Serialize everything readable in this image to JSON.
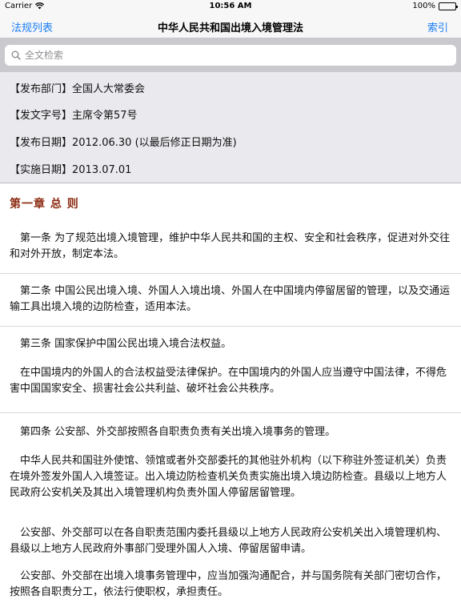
{
  "status_bar": {
    "carrier": "Carrier",
    "time": "10:56 AM",
    "battery": "100%"
  },
  "nav": {
    "back": "法规列表",
    "title": "中华人民共和国出境入境管理法",
    "index": "索引"
  },
  "search": {
    "placeholder": "全文检索",
    "value": ""
  },
  "meta": [
    {
      "label": "【发布部门】",
      "value": "全国人大常委会"
    },
    {
      "label": "【发文字号】",
      "value": "主席令第57号"
    },
    {
      "label": "【发布日期】",
      "value": "2012.06.30 (以最后修正日期为准)"
    },
    {
      "label": "【实施日期】",
      "value": "2013.07.01"
    }
  ],
  "chapter": "第一章 总 则",
  "articles": [
    {
      "paragraphs": [
        "第一条 为了规范出境入境管理，维护中华人民共和国的主权、安全和社会秩序，促进对外交往和对外开放，制定本法。"
      ]
    },
    {
      "paragraphs": [
        "第二条 中国公民出境入境、外国人入境出境、外国人在中国境内停留居留的管理，以及交通运输工具出境入境的边防检查，适用本法。"
      ]
    },
    {
      "paragraphs": [
        "第三条 国家保护中国公民出境入境合法权益。",
        "在中国境内的外国人的合法权益受法律保护。在中国境内的外国人应当遵守中国法律，不得危害中国国家安全、损害社会公共利益、破坏社会公共秩序。"
      ]
    },
    {
      "paragraphs": [
        "第四条 公安部、外交部按照各自职责负责有关出境入境事务的管理。",
        "中华人民共和国驻外使馆、领馆或者外交部委托的其他驻外机构（以下称驻外签证机关）负责在境外签发外国人入境签证。出入境边防检查机关负责实施出境入境边防检查。县级以上地方人民政府公安机关及其出入境管理机构负责外国人停留居留管理。",
        "公安部、外交部可以在各自职责范围内委托县级以上地方人民政府公安机关出入境管理机构、县级以上地方人民政府外事部门受理外国人入境、停留居留申请。",
        "公安部、外交部在出境入境事务管理中，应当加强沟通配合，并与国务院有关部门密切合作，按照各自职责分工，依法行使职权，承担责任。"
      ]
    }
  ]
}
